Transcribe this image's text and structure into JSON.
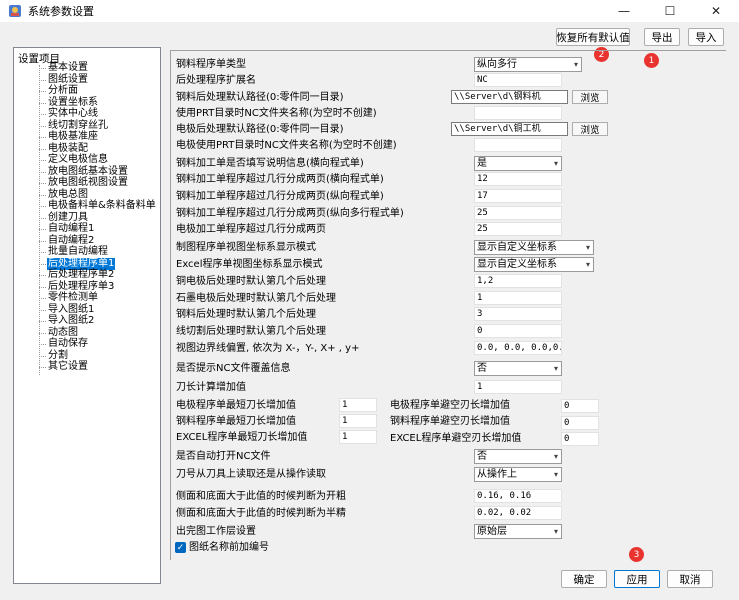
{
  "window": {
    "title": "系统参数设置",
    "minimize": "—",
    "maximize": "☐",
    "close": "✕"
  },
  "toolbar": {
    "restore_defaults": "恢复所有默认值",
    "export": "导出",
    "import": "导入"
  },
  "badges": [
    "1",
    "2",
    "3"
  ],
  "tree": {
    "root": "设置项目",
    "items": [
      "基本设置",
      "图纸设置",
      "分析面",
      "设置坐标系",
      "实体中心线",
      "线切割穿丝孔",
      "电极基准座",
      "电极装配",
      "定义电极信息",
      "放电图纸基本设置",
      "放电图纸视图设置",
      "放电总图",
      "电极备料单&条料备料单",
      "创建刀具",
      "自动编程1",
      "自动编程2",
      "批量自动编程",
      "后处理程序单1",
      "后处理程序单2",
      "后处理程序单3",
      "零件检测单",
      "导入图纸1",
      "导入图纸2",
      "动态图",
      "自动保存",
      "分割",
      "其它设置"
    ],
    "selected_index": 17
  },
  "form": {
    "steel_program_type": {
      "label": "钢料程序单类型",
      "value": "纵向多行"
    },
    "post_ext": {
      "label": "后处理程序扩展名",
      "value": "NC"
    },
    "steel_post_path": {
      "label": "钢料后处理默认路径(0:零件同一目录)",
      "value": "\\\\Server\\d\\钢料机",
      "browse": "浏览"
    },
    "prt_nc_folder": {
      "label": "使用PRT目录时NC文件夹名称(为空时不创建)",
      "value": ""
    },
    "electrode_post_path": {
      "label": "电极后处理默认路径(0:零件同一目录)",
      "value": "\\\\Server\\d\\铜工机",
      "browse": "浏览"
    },
    "electrode_prt_nc_folder": {
      "label": "电极使用PRT目录时NC文件夹名称(为空时不创建)",
      "value": ""
    },
    "steel_fill_desc": {
      "label": "钢料加工单是否填写说明信息(横向程式单)",
      "value": "是"
    },
    "steel_split_h": {
      "label": "钢料加工单程序超过几行分成两页(横向程式单)",
      "value": "12"
    },
    "steel_split_v": {
      "label": "钢料加工单程序超过几行分成两页(纵向程式单)",
      "value": "17"
    },
    "steel_split_vm": {
      "label": "钢料加工单程序超过几行分成两页(纵向多行程式单)",
      "value": "25"
    },
    "electrode_split": {
      "label": "电极加工单程序超过几行分成两页",
      "value": "25"
    },
    "drawing_view_mode": {
      "label": "制图程序单视图坐标系显示模式",
      "value": "显示自定义坐标系"
    },
    "excel_view_mode": {
      "label": "Excel程序单视图坐标系显示模式",
      "value": "显示自定义坐标系"
    },
    "copper_post_default": {
      "label": "铜电极后处理时默认第几个后处理",
      "value": "1,2"
    },
    "graphite_post_default": {
      "label": "石墨电极后处理时默认第几个后处理",
      "value": "1"
    },
    "steel_post_default": {
      "label": "钢料后处理时默认第几个后处理",
      "value": "3"
    },
    "wire_post_default": {
      "label": "线切割后处理时默认第几个后处理",
      "value": "0"
    },
    "view_border_offset": {
      "label": "视图边界线偏置, 依次为 X-，Y-, X+ , y+",
      "value": "0.0, 0.0, 0.0,0.0"
    },
    "nc_overwrite_prompt": {
      "label": "是否提示NC文件覆盖信息",
      "value": "否"
    },
    "tool_length_add": {
      "label": "刀长计算增加值",
      "value": "1"
    },
    "electrode_min_tool": {
      "label": "电极程序单最短刀长增加值",
      "value": "1"
    },
    "steel_min_tool": {
      "label": "钢料程序单最短刀长增加值",
      "value": "1"
    },
    "excel_min_tool": {
      "label": "EXCEL程序单最短刀长增加值",
      "value": "1"
    },
    "electrode_clear_tool": {
      "label": "电极程序单避空刃长增加值",
      "value": "0"
    },
    "steel_clear_tool": {
      "label": "钢料程序单避空刃长增加值",
      "value": "0"
    },
    "excel_clear_tool": {
      "label": "EXCEL程序单避空刃长增加值",
      "value": "0"
    },
    "auto_open_nc": {
      "label": "是否自动打开NC文件",
      "value": "否"
    },
    "tool_source": {
      "label": "刀号从刀具上读取还是从操作读取",
      "value": "从操作上"
    },
    "rough_threshold": {
      "label": "侧面和底面大于此值的时候判断为开粗",
      "value": "0.16, 0.16"
    },
    "semi_threshold": {
      "label": "侧面和底面大于此值的时候判断为半精",
      "value": "0.02, 0.02"
    },
    "output_layer": {
      "label": "出完图工作层设置",
      "value": "原始层"
    },
    "prefix_drawing_no": {
      "label": "图纸名称前加编号",
      "checked": true
    }
  },
  "footer": {
    "ok": "确定",
    "apply": "应用",
    "cancel": "取消"
  },
  "colors": {
    "accent": "#0078d4",
    "badge": "#e8332e",
    "selection": "#0078d7"
  }
}
